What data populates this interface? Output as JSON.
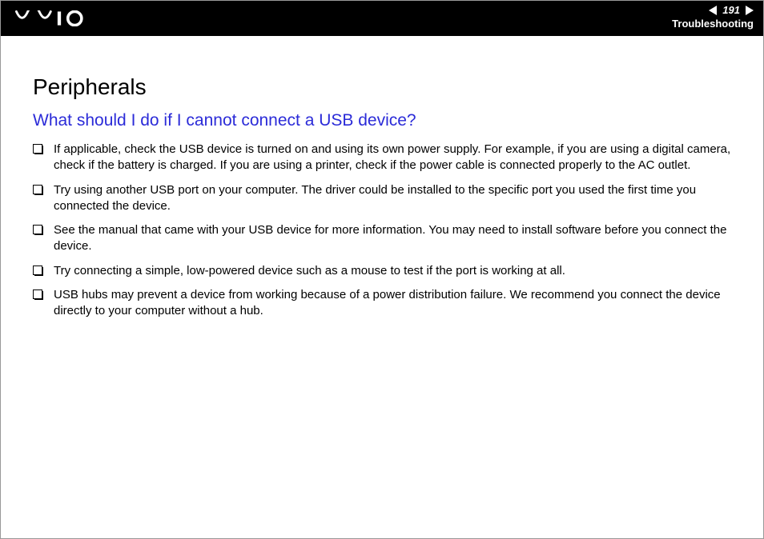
{
  "header": {
    "page_number": "191",
    "section": "Troubleshooting"
  },
  "content": {
    "title": "Peripherals",
    "subheading": "What should I do if I cannot connect a USB device?",
    "bullets": [
      "If applicable, check the USB device is turned on and using its own power supply. For example, if you are using a digital camera, check if the battery is charged. If you are using a printer, check if the power cable is connected properly to the AC outlet.",
      "Try using another USB port on your computer. The driver could be installed to the specific port you used the first time you connected the device.",
      "See the manual that came with your USB device for more information. You may need to install software before you connect the device.",
      "Try connecting a simple, low-powered device such as a mouse to test if the port is working at all.",
      "USB hubs may prevent a device from working because of a power distribution failure. We recommend you connect the device directly to your computer without a hub."
    ]
  }
}
